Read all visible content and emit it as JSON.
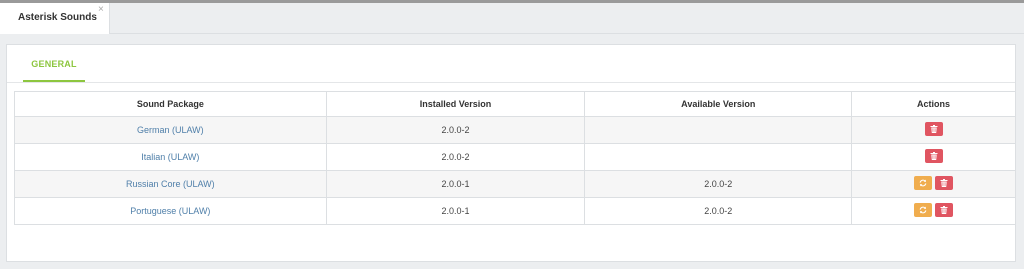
{
  "window": {
    "tab_title": "Asterisk Sounds",
    "close_glyph": "×"
  },
  "panel": {
    "tabs": [
      {
        "label": "GENERAL",
        "active": true
      }
    ]
  },
  "table": {
    "headers": [
      "Sound Package",
      "Installed Version",
      "Available Version",
      "Actions"
    ],
    "rows": [
      {
        "package": "German (ULAW)",
        "installed": "2.0.0-2",
        "available": "",
        "actions": [
          "delete"
        ]
      },
      {
        "package": "Italian (ULAW)",
        "installed": "2.0.0-2",
        "available": "",
        "actions": [
          "delete"
        ]
      },
      {
        "package": "Russian Core (ULAW)",
        "installed": "2.0.0-1",
        "available": "2.0.0-2",
        "actions": [
          "update",
          "delete"
        ]
      },
      {
        "package": "Portuguese (ULAW)",
        "installed": "2.0.0-1",
        "available": "2.0.0-2",
        "actions": [
          "update",
          "delete"
        ]
      }
    ]
  },
  "icons": {
    "delete": "trash-icon",
    "update": "refresh-icon"
  },
  "colors": {
    "accent_green": "#8dc63f",
    "link_blue": "#4f7fa9",
    "delete_red": "#e05561",
    "update_orange": "#f0ad4e"
  }
}
